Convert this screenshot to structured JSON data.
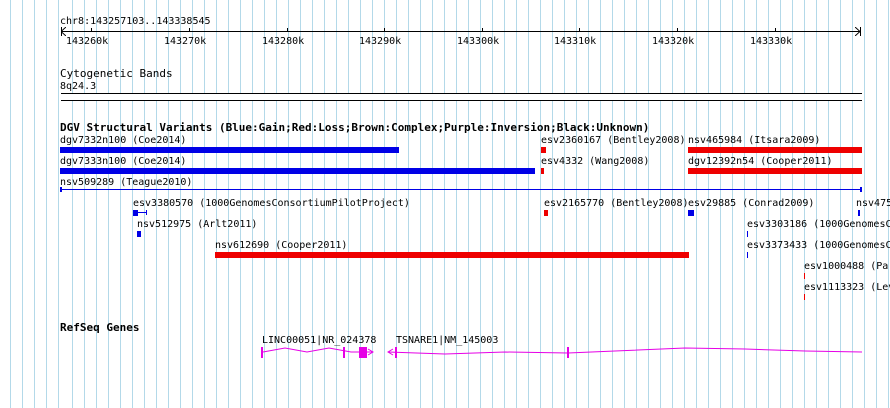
{
  "ruler": {
    "location": "chr8:143257103..143338545",
    "ticks": [
      "143260k",
      "143270k",
      "143280k",
      "143290k",
      "143300k",
      "143310k",
      "143320k",
      "143330k"
    ]
  },
  "cytoband": {
    "title": "Cytogenetic Bands",
    "band": "8q24.3"
  },
  "dgv": {
    "title": "DGV Structural Variants (Blue:Gain;Red:Loss;Brown:Complex;Purple:Inversion;Black:Unknown)",
    "colors": {
      "gain": "#0000e6",
      "loss": "#ee0000"
    },
    "features": [
      {
        "label": "dgv7332n100 (Coe2014)",
        "type": "gain"
      },
      {
        "label": "dgv7333n100 (Coe2014)",
        "type": "gain"
      },
      {
        "label": "nsv509289 (Teague2010)",
        "type": "gain"
      },
      {
        "label": "esv2360167 (Bentley2008)",
        "type": "loss"
      },
      {
        "label": "esv4332 (Wang2008)",
        "type": "loss"
      },
      {
        "label": "nsv465984 (Itsara2009)",
        "type": "loss"
      },
      {
        "label": "dgv12392n54 (Cooper2011)",
        "type": "loss"
      },
      {
        "label": "esv3380570 (1000GenomesConsortiumPilotProject)",
        "type": "gain"
      },
      {
        "label": "nsv512975 (Arlt2011)",
        "type": "gain"
      },
      {
        "label": "esv2165770 (Bentley2008)",
        "type": "loss"
      },
      {
        "label": "esv29885 (Conrad2009)",
        "type": "gain"
      },
      {
        "label": "nsv475",
        "type": "gain"
      },
      {
        "label": "nsv612690 (Cooper2011)",
        "type": "loss"
      },
      {
        "label": "esv3303186 (1000GenomesC",
        "type": "gain"
      },
      {
        "label": "esv3373433 (1000GenomesC",
        "type": "gain"
      },
      {
        "label": "esv1000488 (Par",
        "type": "loss"
      },
      {
        "label": "esv1113323 (Lev",
        "type": "loss"
      }
    ]
  },
  "refseq": {
    "title": "RefSeq Genes",
    "color": "#e600e6",
    "genes": [
      {
        "label": "LINC00051|NR_024378"
      },
      {
        "label": "TSNARE1|NM_145003"
      }
    ]
  }
}
